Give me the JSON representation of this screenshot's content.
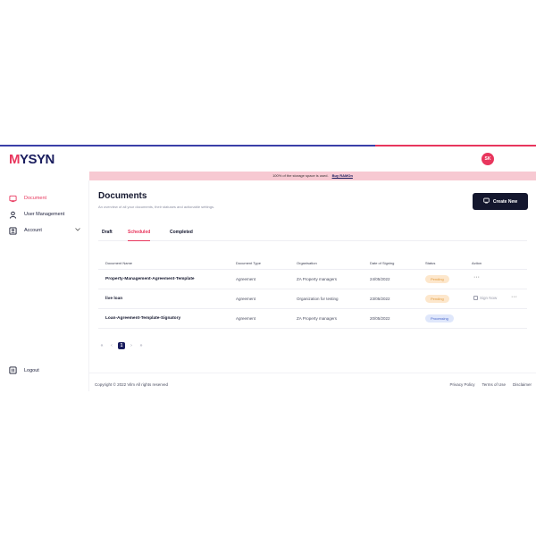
{
  "header": {
    "logo_text": "YSYN",
    "logo_mark": "M",
    "avatar_initials": "SK"
  },
  "banner": {
    "message": "100% of the storage space is used.",
    "link": "Buy RAMOn"
  },
  "sidebar": {
    "items": [
      {
        "label": "Document",
        "icon": "document-icon",
        "active": true
      },
      {
        "label": "User Management",
        "icon": "user-icon",
        "active": false
      },
      {
        "label": "Account",
        "icon": "account-icon",
        "active": false
      }
    ],
    "logout_label": "Logout"
  },
  "main": {
    "title": "Documents",
    "subtitle": "An overview of all your documents, their statuses and actionable settings.",
    "create_label": "Create New",
    "tabs": [
      {
        "label": "Draft",
        "active": false
      },
      {
        "label": "Scheduled",
        "active": true
      },
      {
        "label": "Completed",
        "active": false
      }
    ],
    "table": {
      "headers": [
        "Document Name",
        "Document Type",
        "Organisation",
        "Date of Signing",
        "Status",
        "Action"
      ],
      "rows": [
        {
          "name": "Property-Management-Agreement-Template",
          "type": "Agreement",
          "org": "ZA Property managers",
          "date": "24/05/2022",
          "status": "Pending",
          "sign_now": "",
          "more": "···"
        },
        {
          "name": "live loan",
          "type": "Agreement",
          "org": "Organization for testing",
          "date": "23/05/2022",
          "status": "Pending",
          "sign_now": "Sign Now",
          "more": "···"
        },
        {
          "name": "Loan-Agreement-Template-Signatory",
          "type": "Agreement",
          "org": "ZA Property managers",
          "date": "20/05/2022",
          "status": "Processing",
          "sign_now": "",
          "more": ""
        }
      ]
    },
    "pagination": {
      "first": "«",
      "prev": "‹",
      "current": "1",
      "next": "›",
      "last": "»"
    }
  },
  "footer": {
    "copyright": "Copyright © 2022 Vilm All rights reserved",
    "links": [
      "Privacy Policy",
      "Terms of Use",
      "Disclaimer"
    ]
  },
  "colors": {
    "accent": "#e8365d",
    "brand": "#1a1d5e",
    "banner_bg": "#f7c9d2",
    "pending": "#e09a3b",
    "processing": "#4a67c9"
  }
}
